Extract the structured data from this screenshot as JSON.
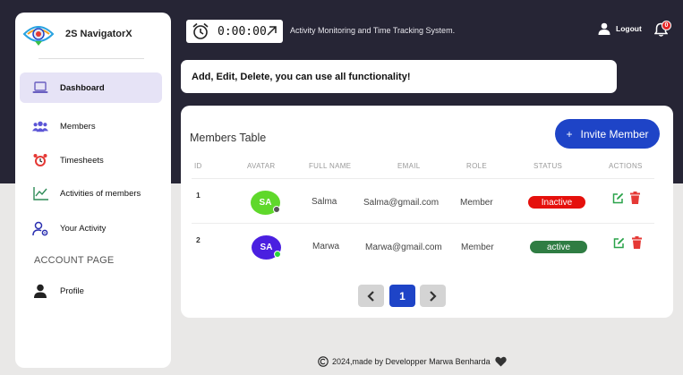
{
  "app": {
    "name": "2S NavigatorX",
    "subtitle": "Activity Monitoring and Time Tracking System."
  },
  "timer": {
    "value": "0:00:00"
  },
  "header": {
    "logout_label": "Logout",
    "notification_count": "0"
  },
  "sidebar": {
    "items": [
      {
        "label": "Dashboard",
        "icon": "laptop-icon",
        "active": true
      },
      {
        "label": "Members",
        "icon": "users-icon"
      },
      {
        "label": "Timesheets",
        "icon": "alarm-clock-icon"
      },
      {
        "label": "Activities of members",
        "icon": "line-chart-icon"
      },
      {
        "label": "Your Activity",
        "icon": "user-gear-icon"
      }
    ],
    "section_title": "ACCOUNT PAGE",
    "account_items": [
      {
        "label": "Profile",
        "icon": "user-icon"
      }
    ]
  },
  "notice": "Add, Edit, Delete, you can use all functionality!",
  "members_table": {
    "title": "Members Table",
    "invite_label": "Invite Member",
    "invite_icon": "plus-icon",
    "columns": [
      "ID",
      "AVATAR",
      "FULL NAME",
      "EMAIL",
      "ROLE",
      "STATUS",
      "ACTIONS"
    ],
    "rows": [
      {
        "id": "1",
        "avatar": "SA",
        "avatar_color": "#5fd82b",
        "online_color": "#555555",
        "name": "Salma",
        "email": "Salma@gmail.com",
        "role": "Member",
        "status": "Inactive",
        "status_color": "#e5100c"
      },
      {
        "id": "2",
        "avatar": "SA",
        "avatar_color": "#4a1fe0",
        "online_color": "#2bd63c",
        "name": "Marwa",
        "email": "Marwa@gmail.com",
        "role": "Member",
        "status": "active",
        "status_color": "#2f7d43"
      }
    ],
    "pagination": {
      "current_page": "1"
    }
  },
  "colors": {
    "accent": "#1e44c7",
    "edit": "#2aa34a",
    "delete": "#e53935",
    "header_bg": "#262535"
  },
  "footer": {
    "text": "2024,made by Developper Marwa Benharda",
    "icon": "heart-icon"
  }
}
